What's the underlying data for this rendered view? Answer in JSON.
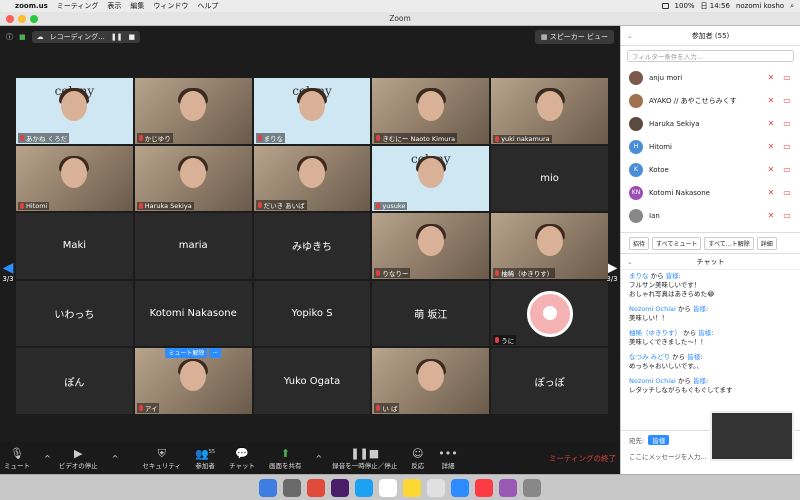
{
  "menubar": {
    "app": "zoom.us",
    "items": [
      "ミーティング",
      "表示",
      "編集",
      "ウィンドウ",
      "ヘルプ"
    ],
    "battery": "100%",
    "clock": "日 14:56",
    "user": "nozomi kosho"
  },
  "window": {
    "title": "Zoom"
  },
  "meeting": {
    "recording_label": "レコーディング...",
    "view_label": "スピーカー ビュー",
    "page_indicator_left": "3/3",
    "page_indicator_right": "3/3",
    "tiles": [
      {
        "name": "あかね くろだ",
        "kind": "colony"
      },
      {
        "name": "かじゆり",
        "kind": "photo"
      },
      {
        "name": "まりな",
        "kind": "colony"
      },
      {
        "name": "きむにー Naoto Kimura",
        "kind": "photo"
      },
      {
        "name": "yuki nakamura",
        "kind": "photo"
      },
      {
        "name": "Hitomi",
        "kind": "photo"
      },
      {
        "name": "Haruka Sekiya",
        "kind": "photo"
      },
      {
        "name": "だいき あいば",
        "kind": "photo"
      },
      {
        "name": "yusuke",
        "kind": "colony"
      },
      {
        "name": "mio",
        "kind": "text"
      },
      {
        "name": "Maki",
        "kind": "text"
      },
      {
        "name": "maria",
        "kind": "text"
      },
      {
        "name": "みゆきち",
        "kind": "text"
      },
      {
        "name": "りなりー",
        "kind": "photo"
      },
      {
        "name": "柚稀（ゆきりす）",
        "kind": "photo"
      },
      {
        "name": "いわっち",
        "kind": "text"
      },
      {
        "name": "Kotomi Nakasone",
        "kind": "text"
      },
      {
        "name": "Yopiko S",
        "kind": "text"
      },
      {
        "name": "萌 坂江",
        "kind": "text"
      },
      {
        "name": "うに",
        "kind": "avatar"
      },
      {
        "name": "ぽん",
        "kind": "text"
      },
      {
        "name": "アイ",
        "kind": "photo"
      },
      {
        "name": "Yuko Ogata",
        "kind": "text"
      },
      {
        "name": "い ば",
        "kind": "photo"
      },
      {
        "name": "ぽっぽ",
        "kind": "text"
      }
    ],
    "colony_logo": "colony",
    "mute_popup": {
      "unmute": "ミュート解除",
      "more": "..."
    }
  },
  "toolbar": {
    "mute": "ミュート",
    "video": "ビデオの停止",
    "security": "セキュリティ",
    "participants": "参加者",
    "participants_count": "55",
    "chat": "チャット",
    "share": "画面を共有",
    "record": "録音を一時停止／停止",
    "reaction": "反応",
    "more": "詳細",
    "end": "ミーティングの終了"
  },
  "participants_panel": {
    "title": "参加者 (55)",
    "filter_placeholder": "フィルター条件を入力...",
    "list": [
      {
        "name": "anju mori",
        "initial": "",
        "color": "#7a5a4a"
      },
      {
        "name": "AYAKO // あやこせらみくす",
        "initial": "",
        "color": "#a07050"
      },
      {
        "name": "Haruka Sekiya",
        "initial": "",
        "color": "#5a4a40"
      },
      {
        "name": "Hitomi",
        "initial": "H",
        "color": "#4a8fd6"
      },
      {
        "name": "Kotoe",
        "initial": "K",
        "color": "#4a8fd6"
      },
      {
        "name": "Kotomi Nakasone",
        "initial": "KN",
        "color": "#9b4fb5"
      },
      {
        "name": "Ian",
        "initial": "",
        "color": "#888888"
      }
    ],
    "buttons": [
      "招待",
      "すべてミュート",
      "すべて…ト解除",
      "詳細"
    ]
  },
  "chat_panel": {
    "title": "チャット",
    "messages": [
      {
        "from": "まりな",
        "to": "皆様",
        "text": "フルサン美味しいです！\nおしゃれ写真はあきらめた😂"
      },
      {
        "from": "Nozomi Ochiai",
        "to": "皆様",
        "text": "美味しい！！"
      },
      {
        "from": "柚稀（ゆきりす）",
        "to": "皆様",
        "text": "美味しくできました〜！！"
      },
      {
        "from": "なつみ みどり",
        "to": "皆様",
        "text": "めっちゃおいしいです。、"
      },
      {
        "from": "Nozomi Ochiai",
        "to": "皆様",
        "text": "レタッチしながらもぐもぐしてます"
      }
    ],
    "from_word": "から",
    "to_label": "宛先:",
    "to_value": "皆様",
    "input_placeholder": "ここにメッセージを入力..."
  }
}
